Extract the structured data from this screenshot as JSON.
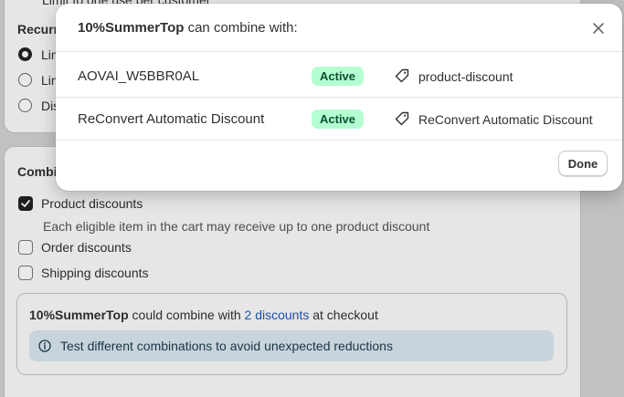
{
  "background": {
    "top_card": {
      "limit_option": "Limit to one use per customer",
      "recurring_heading": "Recurr",
      "radio_1": "Lin",
      "radio_2": "Lin",
      "radio_3": "Dis"
    },
    "combinations": {
      "heading": "Combi",
      "product_discounts": {
        "label": "Product discounts",
        "checked": true
      },
      "product_help": "Each eligible item in the cart may receive up to one product discount",
      "order_discounts": {
        "label": "Order discounts",
        "checked": false
      },
      "shipping_discounts": {
        "label": "Shipping discounts",
        "checked": false
      },
      "summary": {
        "code": "10%SummerTop",
        "text_before": " could combine with ",
        "link": "2 discounts",
        "text_after": " at checkout"
      },
      "notice": {
        "icon": "info-icon",
        "text": "Test different combinations to avoid unexpected reductions"
      }
    }
  },
  "modal": {
    "title_code": "10%SummerTop",
    "title_suffix": " can combine with:",
    "close_icon": "close-icon",
    "rows": [
      {
        "code": "AOVAI_W5BBR0AL",
        "status": "Active",
        "tag_icon": "tag-icon",
        "tag": "product-discount"
      },
      {
        "code": "ReConvert Automatic Discount",
        "status": "Active",
        "tag_icon": "tag-icon",
        "tag": "ReConvert Automatic Discount"
      }
    ],
    "done_label": "Done"
  },
  "colors": {
    "badge_bg": "#b4fed2",
    "badge_text": "#0c5132",
    "link": "#1f59b8",
    "notice_bg": "#d9e6ee"
  }
}
